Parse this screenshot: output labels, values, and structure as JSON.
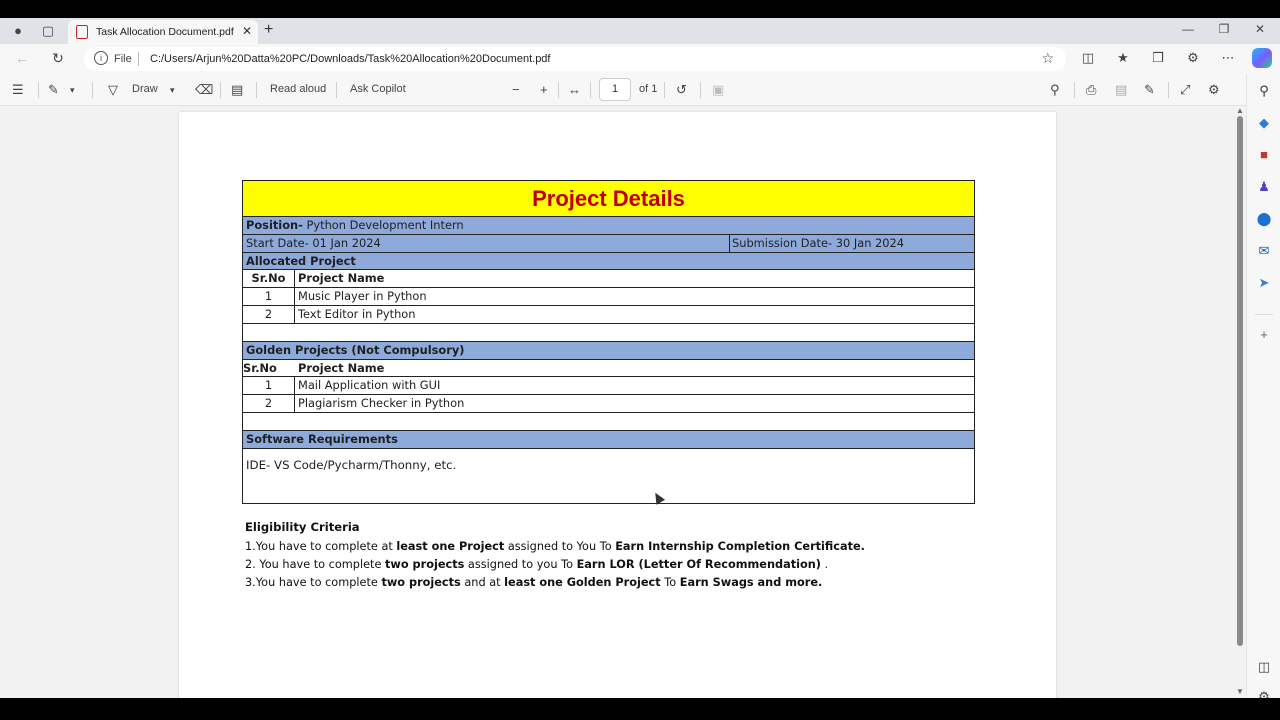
{
  "browser": {
    "tab_title": "Task Allocation Document.pdf",
    "file_label": "File",
    "url": "C:/Users/Arjun%20Datta%20PC/Downloads/Task%20Allocation%20Document.pdf"
  },
  "pdf_toolbar": {
    "draw_label": "Draw",
    "read_aloud_label": "Read aloud",
    "ask_copilot_label": "Ask Copilot",
    "page_number": "1",
    "page_total": "of 1"
  },
  "document": {
    "title": "Project Details",
    "position_label": "Position-",
    "position_value": " Python Development Intern",
    "start_date": "Start Date- 01 Jan 2024",
    "submission_date": "Submission Date- 30 Jan 2024",
    "allocated_heading": "Allocated Project",
    "col_sr": "Sr.No",
    "col_name": "Project Name",
    "allocated_projects": [
      {
        "sr": "1",
        "name": "Music Player in Python"
      },
      {
        "sr": "2",
        "name": "Text Editor in Python"
      }
    ],
    "golden_heading": "Golden Projects (Not Compulsory)",
    "golden_projects": [
      {
        "sr": "1",
        "name": "Mail Application with GUI"
      },
      {
        "sr": "2",
        "name": "Plagiarism Checker in Python"
      }
    ],
    "software_heading": "Software Requirements",
    "software_value": "IDE- VS Code/Pycharm/Thonny, etc.",
    "eligibility_heading": "Eligibility Criteria",
    "eligibility": [
      {
        "a": "1.You have to complete at ",
        "b": "least one Project",
        "c": " assigned to You To ",
        "d": "Earn Internship Completion Certificate.",
        "e": "",
        "f": "",
        "g": ""
      },
      {
        "a": "2. You have to complete ",
        "b": "two projects",
        "c": " assigned to you To ",
        "d": "Earn LOR (Letter Of Recommendation)",
        "e": " .",
        "f": "",
        "g": ""
      },
      {
        "a": "3.You have to complete ",
        "b": "two projects",
        "c": " and at ",
        "d": "least one Golden Project",
        "e": " To ",
        "f": "Earn Swags and more.",
        "g": ""
      }
    ]
  }
}
